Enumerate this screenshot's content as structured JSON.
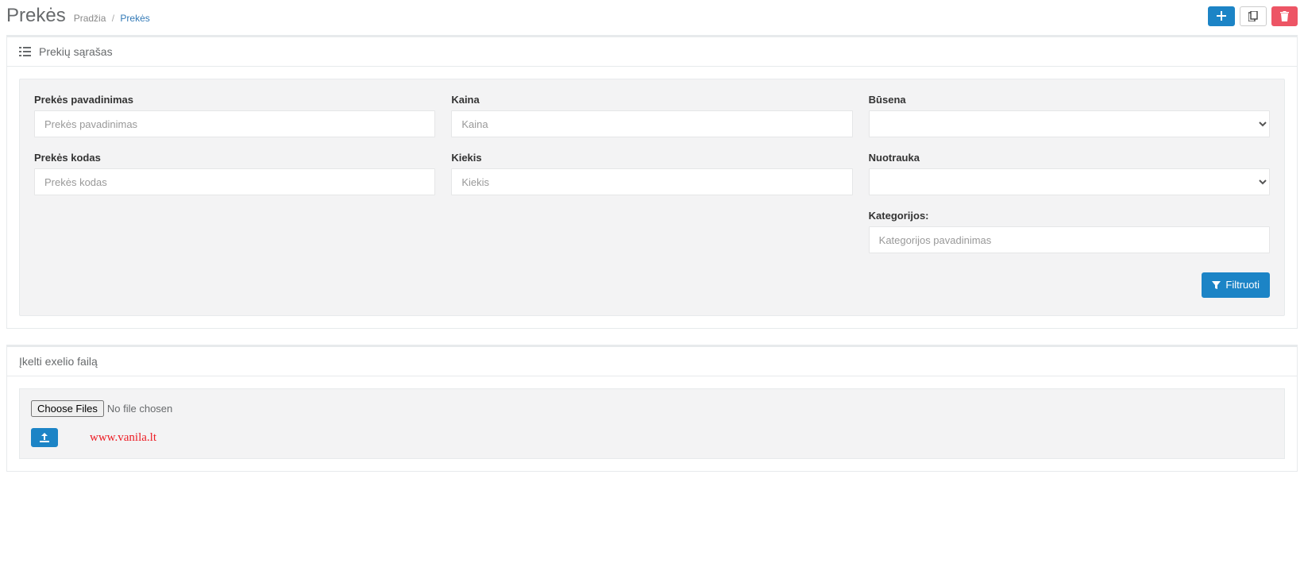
{
  "header": {
    "title": "Prekės",
    "breadcrumb_home": "Pradžia",
    "breadcrumb_current": "Prekės"
  },
  "panel1": {
    "title": "Prekių sąrašas"
  },
  "filters": {
    "name": {
      "label": "Prekės pavadinimas",
      "placeholder": "Prekės pavadinimas",
      "value": ""
    },
    "price": {
      "label": "Kaina",
      "placeholder": "Kaina",
      "value": ""
    },
    "status": {
      "label": "Būsena",
      "selected": ""
    },
    "code": {
      "label": "Prekės kodas",
      "placeholder": "Prekės kodas",
      "value": ""
    },
    "qty": {
      "label": "Kiekis",
      "placeholder": "Kiekis",
      "value": ""
    },
    "photo": {
      "label": "Nuotrauka",
      "selected": ""
    },
    "categories": {
      "label": "Kategorijos:",
      "placeholder": "Kategorijos pavadinimas",
      "value": ""
    },
    "submit_label": "Filtruoti"
  },
  "panel2": {
    "title": "Įkelti exelio failą",
    "choose_files_label": "Choose Files",
    "no_file_text": "No file chosen"
  },
  "watermark": "www.vanila.lt"
}
